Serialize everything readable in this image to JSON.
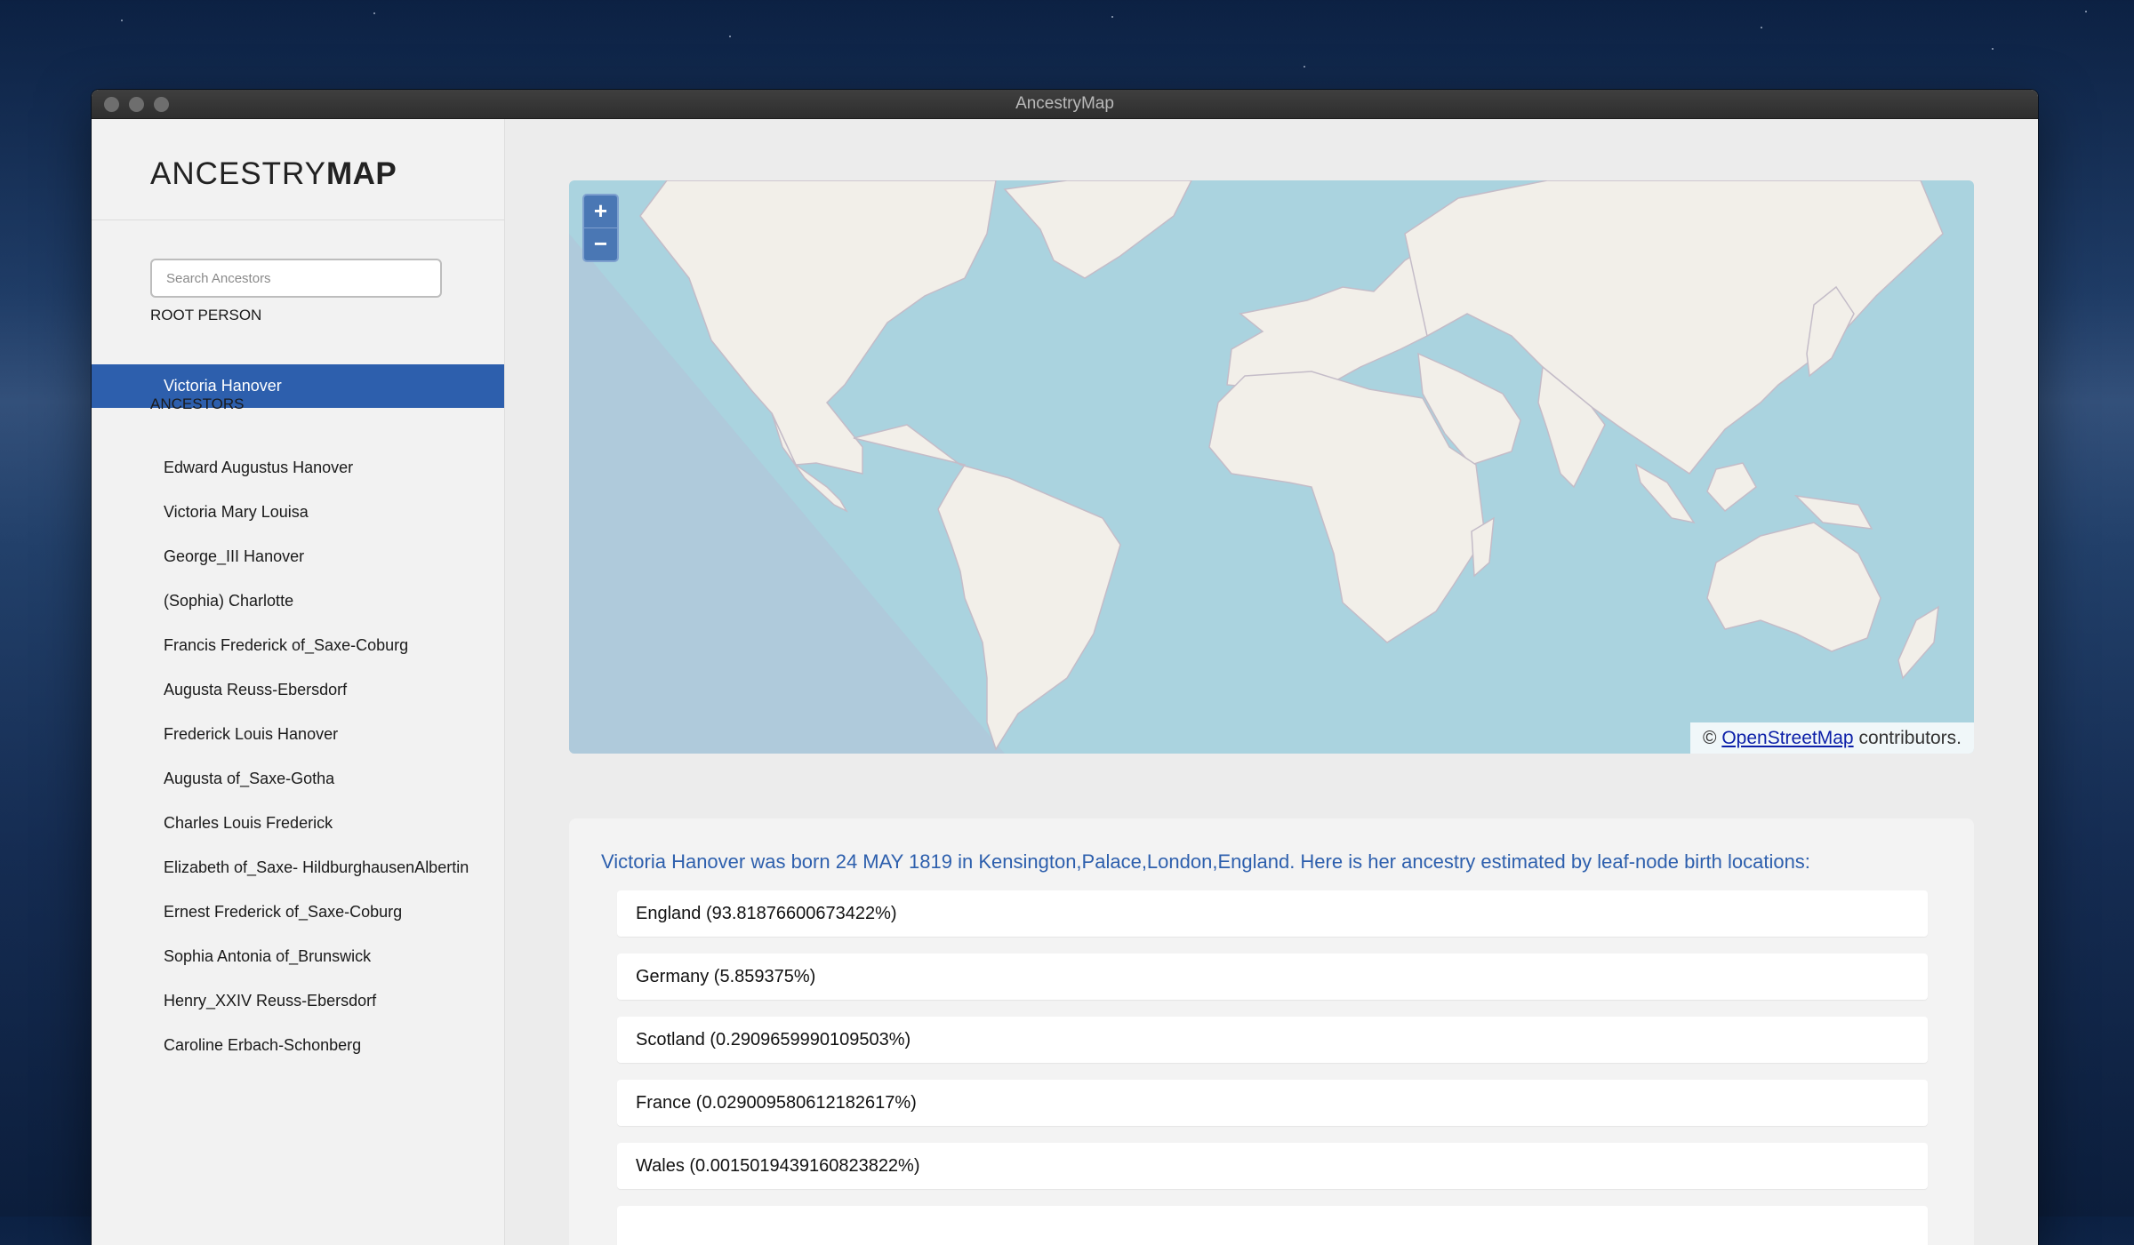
{
  "window": {
    "title": "AncestryMap"
  },
  "brand": {
    "light": "ANCESTRY",
    "bold": "MAP"
  },
  "search": {
    "placeholder": "Search Ancestors",
    "value": ""
  },
  "root_section": {
    "label": "ROOT PERSON",
    "person": "Victoria Hanover"
  },
  "ancestors_section": {
    "label": "ANCESTORS",
    "items": [
      "Edward Augustus Hanover",
      "Victoria Mary Louisa",
      "George_III Hanover",
      "(Sophia) Charlotte",
      "Francis Frederick of_Saxe-Coburg",
      "Augusta Reuss-Ebersdorf",
      "Frederick Louis Hanover",
      "Augusta of_Saxe-Gotha",
      "Charles Louis Frederick",
      "Elizabeth of_Saxe- HildburghausenAlbertin",
      "Ernest Frederick of_Saxe-Coburg",
      "Sophia Antonia of_Brunswick",
      "Henry_XXIV Reuss-Ebersdorf",
      "Caroline Erbach-Schonberg"
    ]
  },
  "map": {
    "zoom_in": "+",
    "zoom_out": "−",
    "attribution_prefix": "©",
    "attribution_link": "OpenStreetMap",
    "attribution_suffix": "contributors.",
    "colors": {
      "water": "#aad3df",
      "land": "#f2efe9",
      "accent": "#4a77b4"
    }
  },
  "details": {
    "summary": "Victoria Hanover was born 24 MAY 1819 in Kensington,Palace,London,England. Here is her ancestry estimated by leaf-node birth locations:",
    "locations": [
      "England (93.81876600673422%)",
      "Germany (5.859375%)",
      "Scotland (0.2909659990109503%)",
      "France (0.029009580612182617%)",
      "Wales (0.0015019439160823822%)"
    ]
  },
  "colors": {
    "brand_blue": "#2d5fad"
  }
}
